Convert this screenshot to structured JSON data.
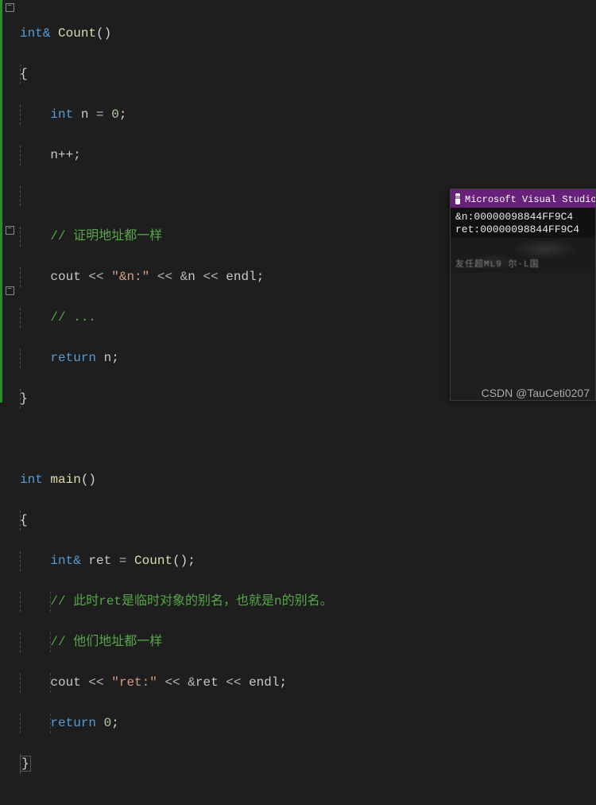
{
  "code": {
    "l1_kw": "int",
    "l1_amp": "&",
    "l1_fn": "Count",
    "l1_paren": "()",
    "l2_brace": "{",
    "l3_kw": "int",
    "l3_id": " n ",
    "l3_eq": "= ",
    "l3_num": "0",
    "l3_semi": ";",
    "l4_text": "n++;",
    "l5_empty": "",
    "l6_cmt": "// 证明地址都一样",
    "l7_cout": "cout ",
    "l7_op1": "<< ",
    "l7_str": "\"&n:\"",
    "l7_op2": " << ",
    "l7_amp": "&",
    "l7_id": "n ",
    "l7_op3": "<< ",
    "l7_endl": "endl",
    "l7_semi": ";",
    "l8_cmt": "// ...",
    "l9_kw": "return",
    "l9_id": " n",
    "l9_semi": ";",
    "l10_brace": "}",
    "l11_empty": "",
    "l12_kw": "int",
    "l12_fn": " main",
    "l12_paren": "()",
    "l13_brace": "{",
    "l14_kw": "int",
    "l14_amp": "&",
    "l14_id": " ret ",
    "l14_eq": "= ",
    "l14_fn": "Count",
    "l14_call": "();",
    "l15_cmt": "// 此时ret是临时对象的别名，也就是n的别名。",
    "l16_cmt": "// 他们地址都一样",
    "l17_cout": "cout ",
    "l17_op1": "<< ",
    "l17_str": "\"ret:\"",
    "l17_op2": " << ",
    "l17_amp": "&",
    "l17_id": "ret ",
    "l17_op3": "<< ",
    "l17_endl": "endl",
    "l17_semi": ";",
    "l18_kw": "return",
    "l18_num": " 0",
    "l18_semi": ";",
    "l19_brace": "}"
  },
  "tooltip": {
    "title": "Microsoft Visual Studio 调",
    "line1": "&n:00000098844FF9C4",
    "line2": "ret:00000098844FF9C4",
    "smudge": "友任超ML9  尔·L国"
  },
  "watermark": "CSDN @TauCeti0207",
  "fold_glyph": "−"
}
